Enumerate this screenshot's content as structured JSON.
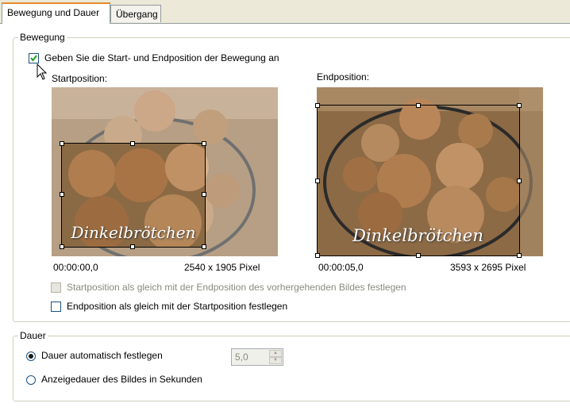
{
  "tabs": [
    {
      "label": "Bewegung und Dauer",
      "active": true
    },
    {
      "label": "Übergang",
      "active": false
    }
  ],
  "bewegung": {
    "legend": "Bewegung",
    "specify_checkbox": {
      "label": "Geben Sie die Start- und Endposition der Bewegung an",
      "checked": true
    },
    "start": {
      "title": "Startposition:",
      "time": "00:00:00,0",
      "size": "2540 x 1905 Pixel",
      "caption": "Dinkelbrötchen",
      "image_icon": "bread-rolls-photo"
    },
    "end": {
      "title": "Endposition:",
      "time": "00:00:05,0",
      "size": "3593 x 2695 Pixel",
      "caption": "Dinkelbrötchen",
      "image_icon": "bread-rolls-photo"
    },
    "same_as_previous": {
      "label": "Startposition als gleich mit der Endposition des vorhergehenden Bildes festlegen",
      "checked": false,
      "enabled": false
    },
    "end_as_start": {
      "label": "Endposition als gleich mit der Startposition festlegen",
      "checked": false,
      "enabled": true
    }
  },
  "dauer": {
    "legend": "Dauer",
    "auto": {
      "label": "Dauer automatisch festlegen",
      "selected": true
    },
    "manual": {
      "label": "Anzeigedauer des Bildes in Sekunden",
      "selected": false
    },
    "seconds_value": "5,0"
  },
  "colors": {
    "tab_accent": "#e68b2c",
    "control_border": "#1c5180"
  }
}
